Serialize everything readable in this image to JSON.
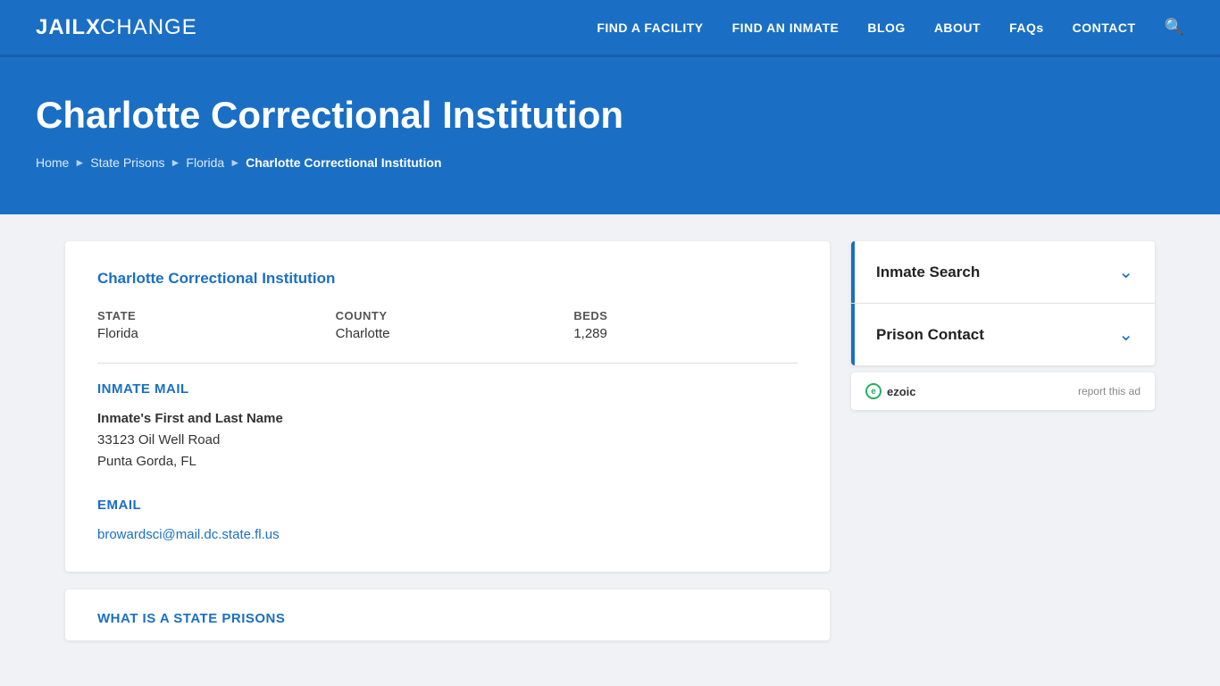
{
  "brand": {
    "name_bold": "JAIL",
    "name_x": "X",
    "name_rest": "CHANGE"
  },
  "navbar": {
    "links": [
      {
        "id": "find-facility",
        "label": "FIND A FACILITY"
      },
      {
        "id": "find-inmate",
        "label": "FIND AN INMATE"
      },
      {
        "id": "blog",
        "label": "BLOG"
      },
      {
        "id": "about",
        "label": "ABOUT"
      },
      {
        "id": "faqs",
        "label": "FAQs"
      },
      {
        "id": "contact",
        "label": "CONTACT"
      }
    ]
  },
  "hero": {
    "title": "Charlotte Correctional Institution",
    "breadcrumb": [
      {
        "label": "Home",
        "href": true
      },
      {
        "label": "State Prisons",
        "href": true
      },
      {
        "label": "Florida",
        "href": true
      },
      {
        "label": "Charlotte Correctional Institution",
        "href": false
      }
    ]
  },
  "facility": {
    "card_title": "Charlotte Correctional Institution",
    "state_label": "STATE",
    "state_value": "Florida",
    "county_label": "COUNTY",
    "county_value": "Charlotte",
    "beds_label": "BEDS",
    "beds_value": "1,289",
    "inmate_mail_title": "INMATE MAIL",
    "inmate_name": "Inmate's First and Last Name",
    "address_line1": "33123 Oil Well Road",
    "address_line2": "Punta Gorda, FL",
    "email_title": "EMAIL",
    "email_value": "browardsci@mail.dc.state.fl.us",
    "bottom_section_title": "WHAT IS A STATE PRISONS"
  },
  "sidebar": {
    "accordion_items": [
      {
        "id": "inmate-search",
        "label": "Inmate Search",
        "active": true
      },
      {
        "id": "prison-contact",
        "label": "Prison Contact",
        "active": true
      }
    ],
    "ad": {
      "provider": "ezoic",
      "provider_label": "ezoic",
      "report_label": "report this ad"
    }
  }
}
